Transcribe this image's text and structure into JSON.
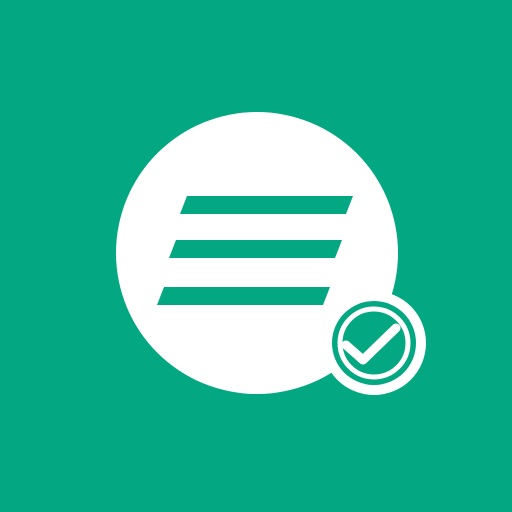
{
  "icon": {
    "name": "task-list-done-icon",
    "background_color": "#03A882",
    "foreground_color": "#FFFFFF",
    "list_lines": 3,
    "badge": "checkmark-icon"
  }
}
